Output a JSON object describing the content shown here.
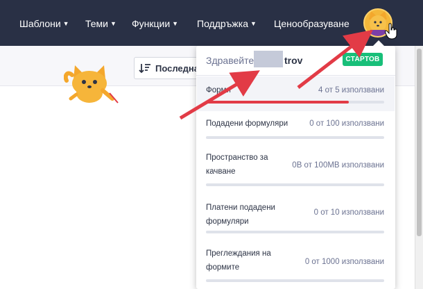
{
  "nav": {
    "items": [
      {
        "label": "Шаблони",
        "has_caret": true
      },
      {
        "label": "Теми",
        "has_caret": true
      },
      {
        "label": "Функции",
        "has_caret": true
      },
      {
        "label": "Поддръжка",
        "has_caret": true
      },
      {
        "label": "Ценообразуване",
        "has_caret": false
      }
    ],
    "bg_color": "#293045"
  },
  "toolbar": {
    "sort_label": "Последна"
  },
  "account_panel": {
    "greeting": "Здравейте",
    "name_visible_part": "trov",
    "plan_badge": "СТАРТОВ",
    "plan_color": "#18bf79",
    "usage": [
      {
        "label": "Форми",
        "count_text": "4 от 5 използвани",
        "used": 4,
        "limit": 5,
        "highlighted": true
      },
      {
        "label": "Подадени формуляри",
        "count_text": "0 от 100 използвани",
        "used": 0,
        "limit": 100,
        "highlighted": false
      },
      {
        "label": "Пространство за качване",
        "count_text": "0B от 100MB използвани",
        "used": 0,
        "limit": 100,
        "highlighted": false
      },
      {
        "label": "Платени подадени формуляри",
        "count_text": "0 от 10 използвани",
        "used": 0,
        "limit": 10,
        "highlighted": false
      },
      {
        "label": "Преглеждания на формите",
        "count_text": "0 от 1000 използвани",
        "used": 0,
        "limit": 1000,
        "highlighted": false
      }
    ],
    "bar_fill_color": "#e23b46"
  }
}
